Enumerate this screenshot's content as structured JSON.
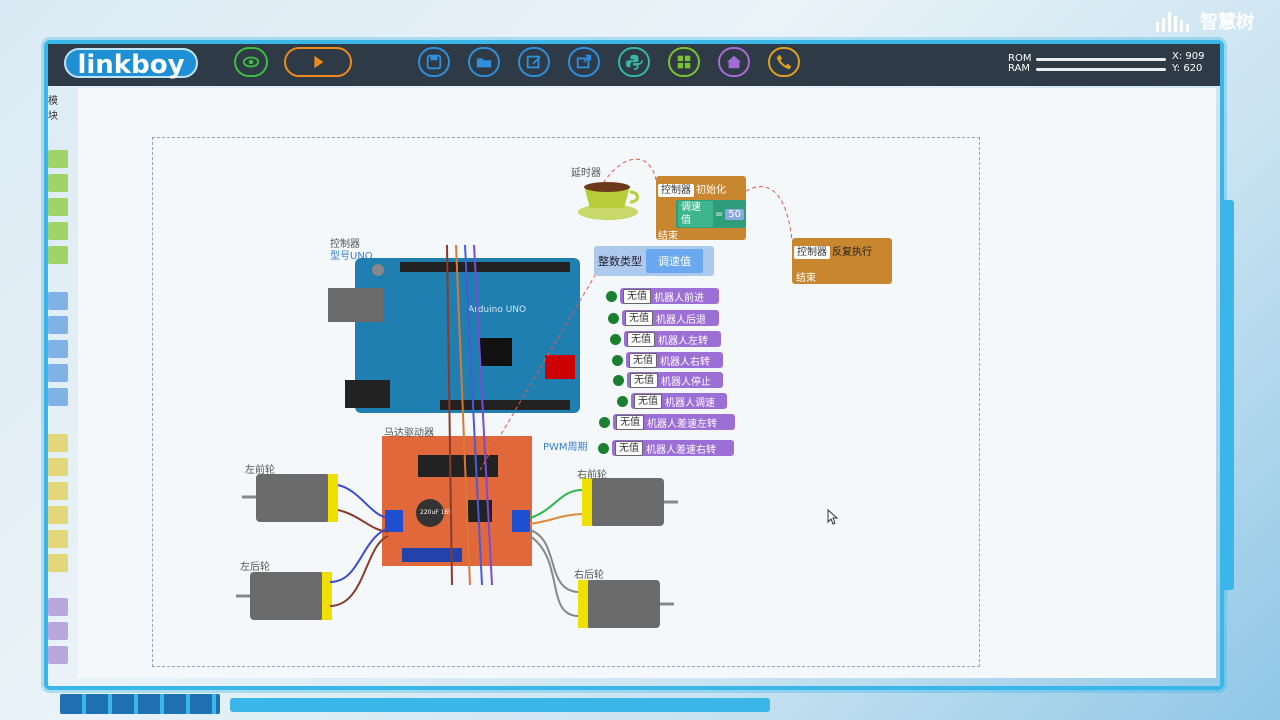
{
  "app": {
    "logo": "linkboy",
    "brand_watermark": "智慧树"
  },
  "toolbar": {
    "buttons": [
      {
        "name": "view-button",
        "icon": "eye-icon",
        "color": "#3fbf3f"
      },
      {
        "name": "run-button",
        "icon": "play-icon",
        "color": "#f08a1c"
      },
      {
        "name": "save-button",
        "icon": "floppy-icon",
        "color": "#2f8fdc"
      },
      {
        "name": "open-button",
        "icon": "folder-icon",
        "color": "#2f8fdc"
      },
      {
        "name": "edit-button",
        "icon": "edit-icon",
        "color": "#2f8fdc"
      },
      {
        "name": "export-button",
        "icon": "export-icon",
        "color": "#2f8fdc"
      },
      {
        "name": "python-button",
        "icon": "python-icon",
        "color": "#35b7a3"
      },
      {
        "name": "grid-button",
        "icon": "grid-icon",
        "color": "#7cc230"
      },
      {
        "name": "home-button",
        "icon": "home-icon",
        "color": "#a56bd6"
      },
      {
        "name": "call-button",
        "icon": "phone-icon",
        "color": "#e0a21c"
      }
    ],
    "rom_label": "ROM",
    "ram_label": "RAM",
    "x_readout": "X: 909",
    "y_readout": "Y: 620"
  },
  "palette_tab": "模块",
  "components": {
    "controller_label": "控制器",
    "controller_model": "型号UNO",
    "board_text": "Arduino UNO",
    "motor_driver_label": "马达驱动器",
    "driver_cap_text": "220uF 16V",
    "pwm_label": "PWM周期",
    "delay_label": "延时器",
    "left_front_wheel": "左前轮",
    "left_rear_wheel": "左后轮",
    "right_front_wheel": "右前轮",
    "right_rear_wheel": "右后轮"
  },
  "blocks": {
    "init": {
      "tag": "控制器",
      "text": "初始化",
      "var": "调速值",
      "op": "=",
      "value": "50",
      "end": "结束"
    },
    "loop": {
      "tag": "控制器",
      "text": "反复执行",
      "end": "结束"
    },
    "variable": {
      "type": "整数类型",
      "name": "调速值"
    },
    "functions": [
      {
        "tag": "无值",
        "text": "机器人前进"
      },
      {
        "tag": "无值",
        "text": "机器人后退"
      },
      {
        "tag": "无值",
        "text": "机器人左转"
      },
      {
        "tag": "无值",
        "text": "机器人右转"
      },
      {
        "tag": "无值",
        "text": "机器人停止"
      },
      {
        "tag": "无值",
        "text": "机器人调速"
      },
      {
        "tag": "无值",
        "text": "机器人差速左转"
      },
      {
        "tag": "无值",
        "text": "机器人差速右转"
      }
    ]
  },
  "colors": {
    "frame": "#3ab7e8",
    "toolbar": "#2e3a45",
    "event_block": "#c8862e",
    "func_block": "#9c6fd6",
    "var_block": "#6aa8ef"
  }
}
